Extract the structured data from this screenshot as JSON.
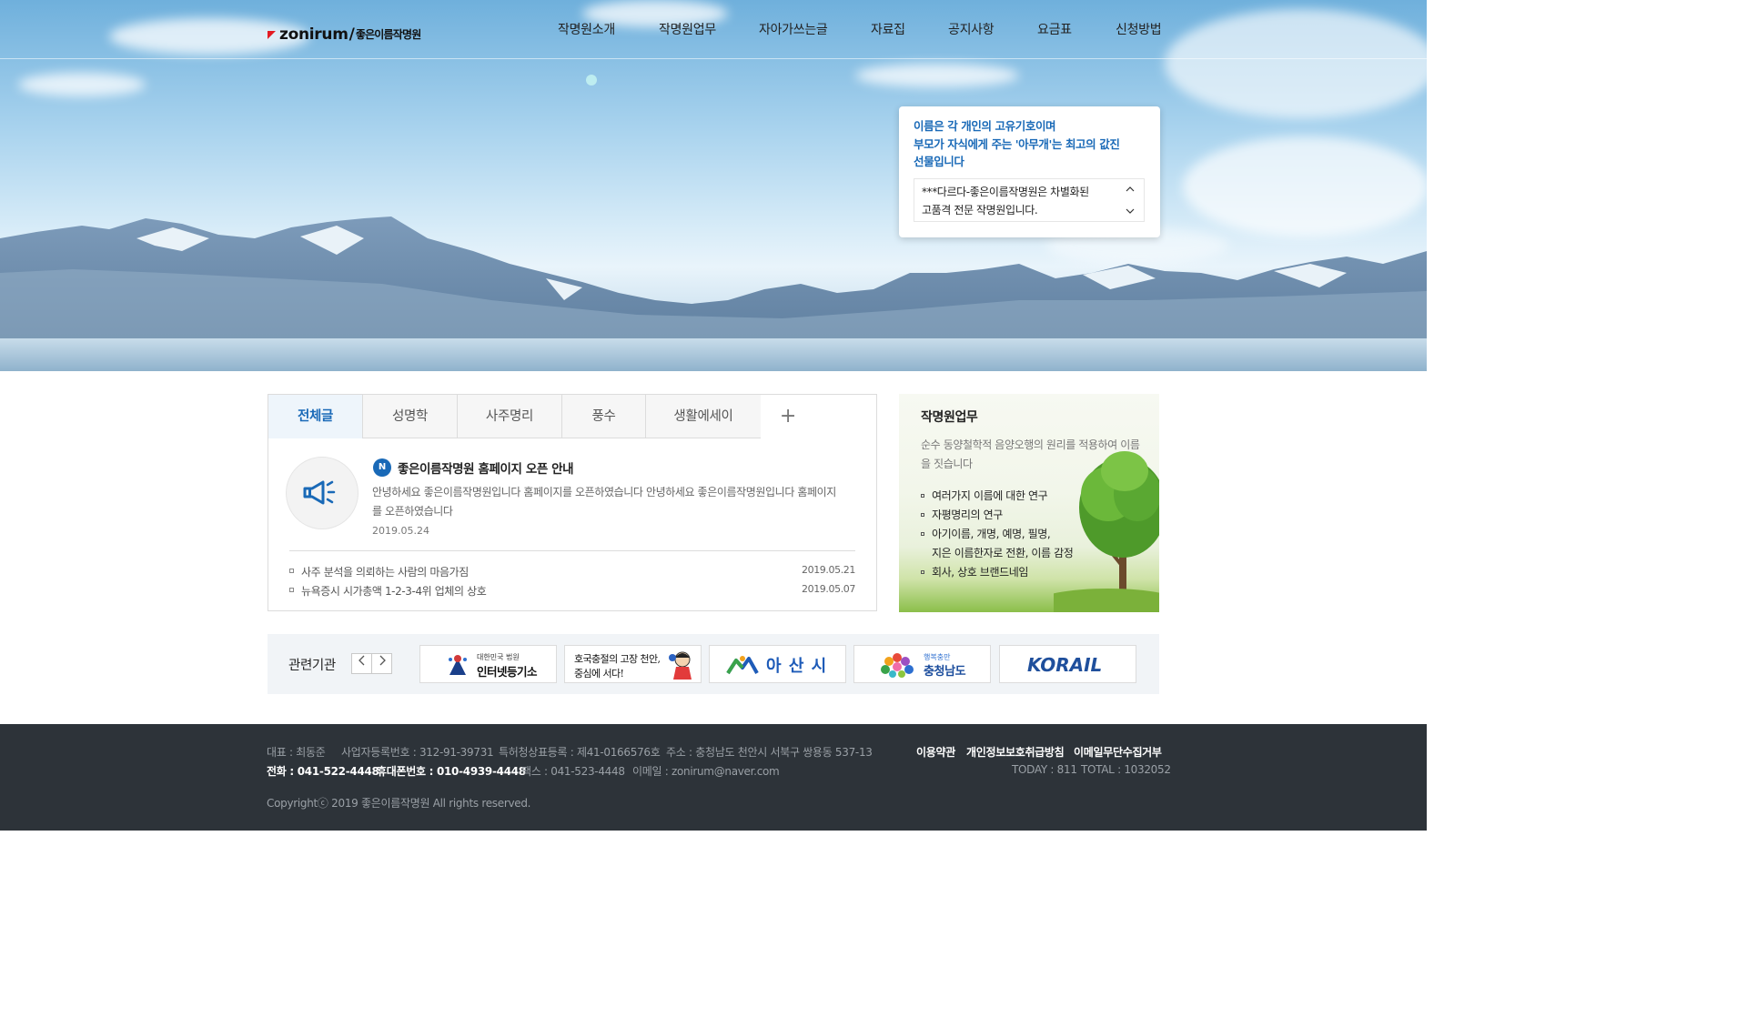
{
  "header": {
    "logo_brand": "zonirum",
    "logo_slash": "/",
    "logo_korean": "좋은이름작명원",
    "nav": [
      "작명원소개",
      "작명원업무",
      "자아가쓰는글",
      "자료집",
      "공지사항",
      "요금표",
      "신청방법"
    ]
  },
  "hero_quote": {
    "lines": [
      "이름은 각 개인의 고유기호이며",
      "부모가 자식에게 주는 '아무개'는 최고의 값진",
      "선물입니다"
    ],
    "ticker_lines": [
      "***다르다-좋은이름작명원은 차별화된",
      "고품격 전문 작명원입니다."
    ]
  },
  "board": {
    "tabs": [
      "전체글",
      "성명학",
      "사주명리",
      "풍수",
      "생활에세이",
      "+"
    ],
    "notice": {
      "badge": "N",
      "title": "좋은이름작명원 홈페이지 오픈 안내",
      "body": "안녕하세요 좋은이름작명원입니다 홈페이지를 오픈하였습니다 안녕하세요 좋은이름작명원입니다 홈페이지를 오픈하였습니다",
      "date": "2019.05.24"
    },
    "rows": [
      {
        "title": "사주 분석을 의뢰하는 사람의 마음가짐",
        "date": "2019.05.21"
      },
      {
        "title": "뉴욕증시 시가총액 1-2-3-4위 업체의 상호",
        "date": "2019.05.07"
      }
    ]
  },
  "side": {
    "title": "작명원업무",
    "lead": "순수 동양철학적 음양오행의 원리를 적용하여 이름을 짓습니다",
    "items": [
      "여러가지 이름에 대한 연구",
      "자평명리의 연구",
      "아기이름, 개명, 예명, 필명,",
      "지은 이름한자로 전환, 이름 감정",
      "회사, 상호 브랜드네임"
    ]
  },
  "related": {
    "label": "관련기관",
    "prev": "‹",
    "next": "›",
    "logos": {
      "court_small": "대한민국 법원",
      "court_main": "인터넷등기소",
      "cheonan_line1": "호국충절의 고장 천안,",
      "cheonan_line2": "중심에 서다!",
      "asan": "아 산 시",
      "chungnam_small": "행복충만",
      "chungnam_main": "충청남도",
      "korail": "KORAIL"
    }
  },
  "footer": {
    "line1": [
      "대표 : 최동준",
      "사업자등록번호 : 312-91-39731",
      "특허청상표등록 : 제41-0166576호",
      "주소 : 충청남도 천안시 서북구 쌍용동 537-13"
    ],
    "phone": "전화 : 041-522-4448",
    "mobile": "휴대폰번호 : 010-4939-4448",
    "fax": "팩스 : 041-523-4448",
    "email": "이메일 : zonirum@naver.com",
    "copyright": "Copyrightⓒ 2019 좋은이름작명원 All rights reserved.",
    "links": [
      "이용약관",
      "개인정보보호취급방침",
      "이메일무단수집거부"
    ],
    "today": "TODAY : 811",
    "total": "TOTAL : 1032052"
  },
  "colors": {
    "accent": "#1969b7",
    "footer_bg": "#2d3339",
    "related_bg": "#f1f4f7"
  }
}
